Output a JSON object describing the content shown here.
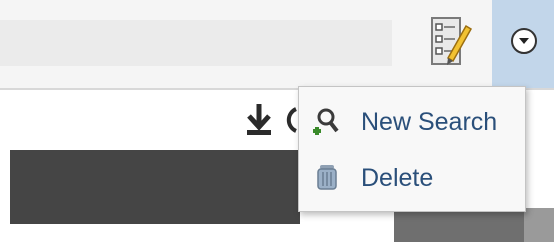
{
  "toolbar": {
    "search_value": "",
    "checklist_icon": "checklist-pencil-icon",
    "dropdown_icon": "chevron-down-circle-icon",
    "dropdown_accent": "#c2d6ea"
  },
  "secondary_toolbar": {
    "download_icon": "download-icon"
  },
  "menu": {
    "items": [
      {
        "label": "New Search",
        "icon": "new-search-icon"
      },
      {
        "label": "Delete",
        "icon": "trash-icon"
      }
    ],
    "label_color": "#2a4f7a"
  }
}
